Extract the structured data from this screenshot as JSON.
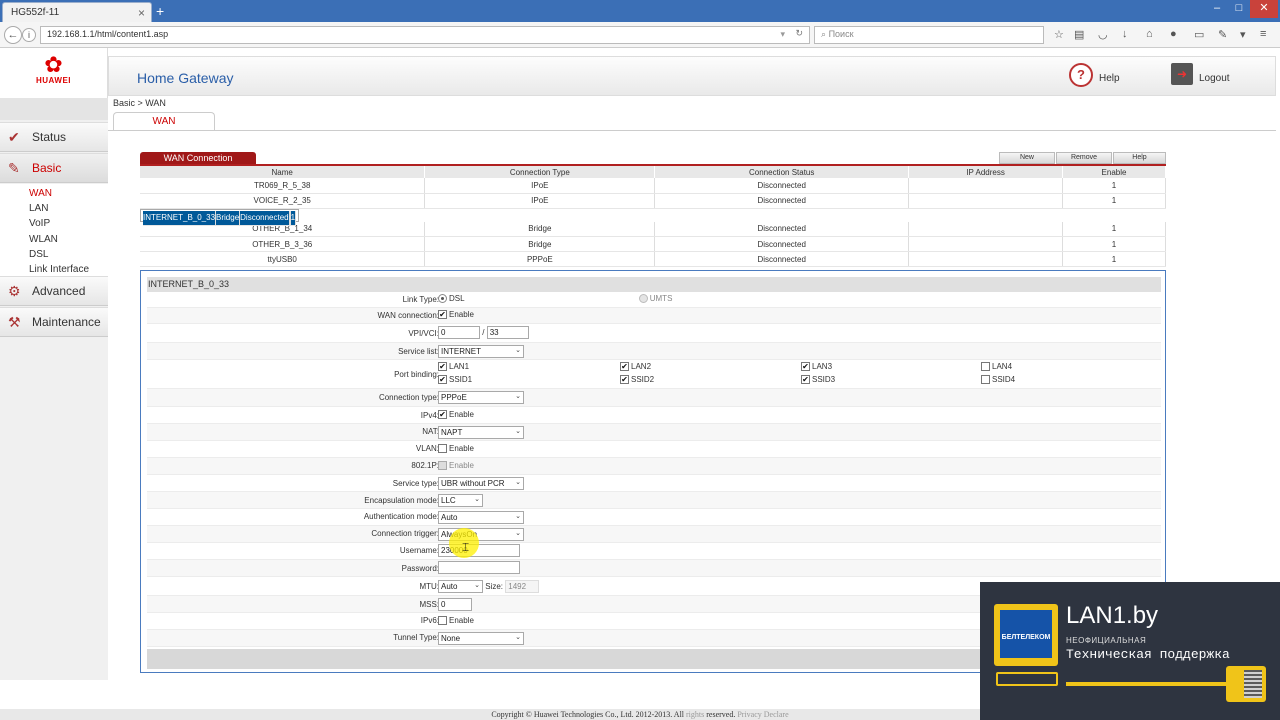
{
  "browser": {
    "tab_title": "HG552f-11",
    "new_tab": "+",
    "url": "192.168.1.1/html/content1.asp",
    "search_placeholder": "Поиск",
    "win_min": "–",
    "win_max": "□",
    "win_close": "✕"
  },
  "sidebar": {
    "brand": "HUAWEI",
    "items": [
      {
        "label": "Status",
        "icon": "status-icon"
      },
      {
        "label": "Basic",
        "icon": "basic-icon",
        "active": true
      },
      {
        "label": "Advanced",
        "icon": "advanced-icon"
      },
      {
        "label": "Maintenance",
        "icon": "maintenance-icon"
      }
    ],
    "subitems": [
      "WAN",
      "LAN",
      "VoIP",
      "WLAN",
      "DSL",
      "Link Interface"
    ]
  },
  "header": {
    "title": "Home Gateway",
    "help": "Help",
    "logout": "Logout"
  },
  "breadcrumb": "Basic > WAN",
  "page_tab": "WAN",
  "wan": {
    "section_title": "WAN Connection",
    "buttons": {
      "new": "New",
      "remove": "Remove",
      "help": "Help"
    },
    "columns": [
      "Name",
      "Connection Type",
      "Connection Status",
      "IP Address",
      "Enable"
    ],
    "rows": [
      [
        "TR069_R_5_38",
        "IPoE",
        "Disconnected",
        "",
        "1"
      ],
      [
        "VOICE_R_2_35",
        "IPoE",
        "Disconnected",
        "",
        "1"
      ],
      [
        "INTERNET_B_0_33",
        "Bridge",
        "Disconnected",
        "",
        "1"
      ],
      [
        "OTHER_B_1_34",
        "Bridge",
        "Disconnected",
        "",
        "1"
      ],
      [
        "OTHER_B_3_36",
        "Bridge",
        "Disconnected",
        "",
        "1"
      ],
      [
        "ttyUSB0",
        "PPPoE",
        "Disconnected",
        "",
        "1"
      ]
    ],
    "selected_row": 2
  },
  "detail": {
    "header": "INTERNET_B_0_33",
    "link_type_label": "Link Type:",
    "link_dsl": "DSL",
    "link_umts": "UMTS",
    "wan_conn_label": "WAN connection:",
    "enable": "Enable",
    "vpi_label": "VPI/VCI:",
    "vpi": "0",
    "slash": "/",
    "vci": "33",
    "service_list_label": "Service list:",
    "service_list": "INTERNET",
    "port_binding_label": "Port binding:",
    "ports_row1": [
      "LAN1",
      "LAN2",
      "LAN3",
      "LAN4"
    ],
    "ports_row2": [
      "SSID1",
      "SSID2",
      "SSID3",
      "SSID4"
    ],
    "conn_type_label": "Connection type:",
    "conn_type": "PPPoE",
    "ipv4_label": "IPv4:",
    "nat_label": "NAT:",
    "nat": "NAPT",
    "vlan_label": "VLAN:",
    "p8021_label": "802.1P:",
    "service_type_label": "Service type:",
    "service_type": "UBR without PCR",
    "encap_label": "Encapsulation mode:",
    "encap": "LLC",
    "auth_label": "Authentication mode:",
    "auth": "Auto",
    "trigger_label": "Connection trigger:",
    "trigger": "AlwaysOn",
    "username_label": "Username:",
    "username": "230000",
    "password_label": "Password:",
    "mtu_label": "MTU:",
    "mtu": "Auto",
    "size_label": "Size:",
    "size": "1492",
    "mss_label": "MSS:",
    "mss": "0",
    "ipv6_label": "IPv6:",
    "tunnel_label": "Tunnel Type:",
    "tunnel": "None"
  },
  "footer": {
    "copyright": "Copyright © Huawei Technologies Co., Ltd. 2012-2013. All",
    "rights": "rights",
    "reserved": "reserved.",
    "privacy": "Privacy Declare"
  },
  "overlay": {
    "title": "LAN1.by",
    "sub1": "НЕОФИЦИАЛЬНАЯ",
    "sub2": "Техническая поддержка",
    "logo_text": "БЕЛТЕЛЕКОМ"
  }
}
